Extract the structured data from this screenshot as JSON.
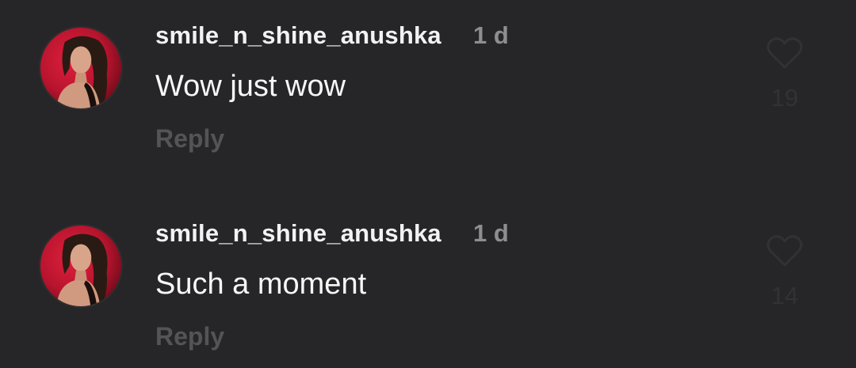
{
  "comments": [
    {
      "username": "smile_n_shine_anushka",
      "time": "1 d",
      "text": "Wow just wow",
      "reply_label": "Reply",
      "like_count": "19",
      "avatar_icon": "profile-avatar",
      "like_icon": "heart-outline-icon"
    },
    {
      "username": "smile_n_shine_anushka",
      "time": "1 d",
      "text": "Such a moment",
      "reply_label": "Reply",
      "like_count": "14",
      "avatar_icon": "profile-avatar",
      "like_icon": "heart-outline-icon"
    }
  ],
  "colors": {
    "background": "#262628",
    "username": "#f2f2f2",
    "time": "#8e8e92",
    "reply": "#545457",
    "like": "#323235"
  }
}
